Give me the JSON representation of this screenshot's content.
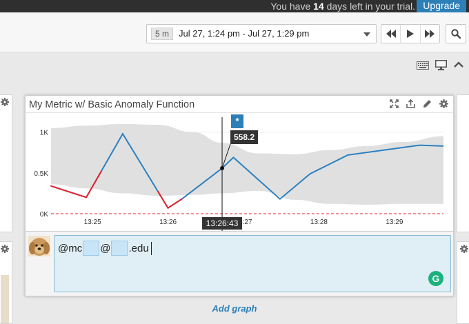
{
  "trial": {
    "text_before": "You have ",
    "days": "14",
    "text_after": " days left in your trial.",
    "upgrade_label": "Upgrade"
  },
  "time_picker": {
    "span": "5 m",
    "range": "Jul 27, 1:24 pm - Jul 27, 1:29 pm"
  },
  "icons": {
    "nav": [
      "rewind-icon",
      "play-icon",
      "fast-forward-icon"
    ],
    "search": "search-icon",
    "toolbar": [
      "keyboard-icon",
      "monitor-icon",
      "chevron-up-icon"
    ],
    "widget": [
      "expand-icon",
      "share-icon",
      "pencil-icon",
      "gear-icon"
    ]
  },
  "widget": {
    "title": "My Metric w/ Basic Anomaly Function"
  },
  "chart_data": {
    "type": "line",
    "title": "My Metric w/ Basic Anomaly Function",
    "y_ticks": [
      "1K",
      "0.5K",
      "0K"
    ],
    "ylim": [
      0,
      1150
    ],
    "x_ticks": [
      "13:25",
      "13:26",
      "13:27",
      "13:28",
      "13:29"
    ],
    "x_range": [
      "13:24:27",
      "13:29:39"
    ],
    "grid": "horizontal",
    "colors": {
      "normal": "#2b80c0",
      "anomaly": "#e3232b",
      "band": "#e0e0e0",
      "zero_line": "#e3232b",
      "event": "#2d7fb8"
    },
    "series": [
      {
        "x": [
          "13:24:27",
          "13:24:55",
          "13:25:24",
          "13:26:00",
          "13:26:11",
          "13:26:43",
          "13:26:52",
          "13:27:29",
          "13:27:53",
          "13:28:23",
          "13:29:20",
          "13:29:39"
        ],
        "y": [
          340,
          200,
          980,
          70,
          180,
          558,
          690,
          180,
          490,
          720,
          840,
          830
        ]
      }
    ],
    "anomaly_segments": [
      [
        "13:24:27",
        "13:24:55"
      ],
      [
        "13:24:55",
        "13:25:07"
      ],
      [
        "13:25:52",
        "13:26:00"
      ],
      [
        "13:26:00",
        "13:26:11"
      ]
    ],
    "band": {
      "x": [
        "13:24:27",
        "13:24:55",
        "13:25:24",
        "13:25:52",
        "13:26:20",
        "13:26:43",
        "13:27:12",
        "13:27:41",
        "13:28:09",
        "13:28:38",
        "13:29:07",
        "13:29:39"
      ],
      "upper": [
        1050,
        1080,
        1100,
        1090,
        1000,
        870,
        740,
        730,
        780,
        830,
        880,
        950
      ],
      "lower": [
        360,
        310,
        250,
        220,
        230,
        250,
        280,
        170,
        120,
        110,
        120,
        120
      ]
    },
    "event_marker": {
      "label": "*",
      "time": "13:26:43"
    },
    "tooltip": {
      "value": "558.2",
      "time": "13:26:43"
    }
  },
  "comment": {
    "prefix": "@mc",
    "at": "@",
    "suffix": ".edu",
    "grammarly_letter": "G"
  },
  "add_graph_label": "Add graph"
}
